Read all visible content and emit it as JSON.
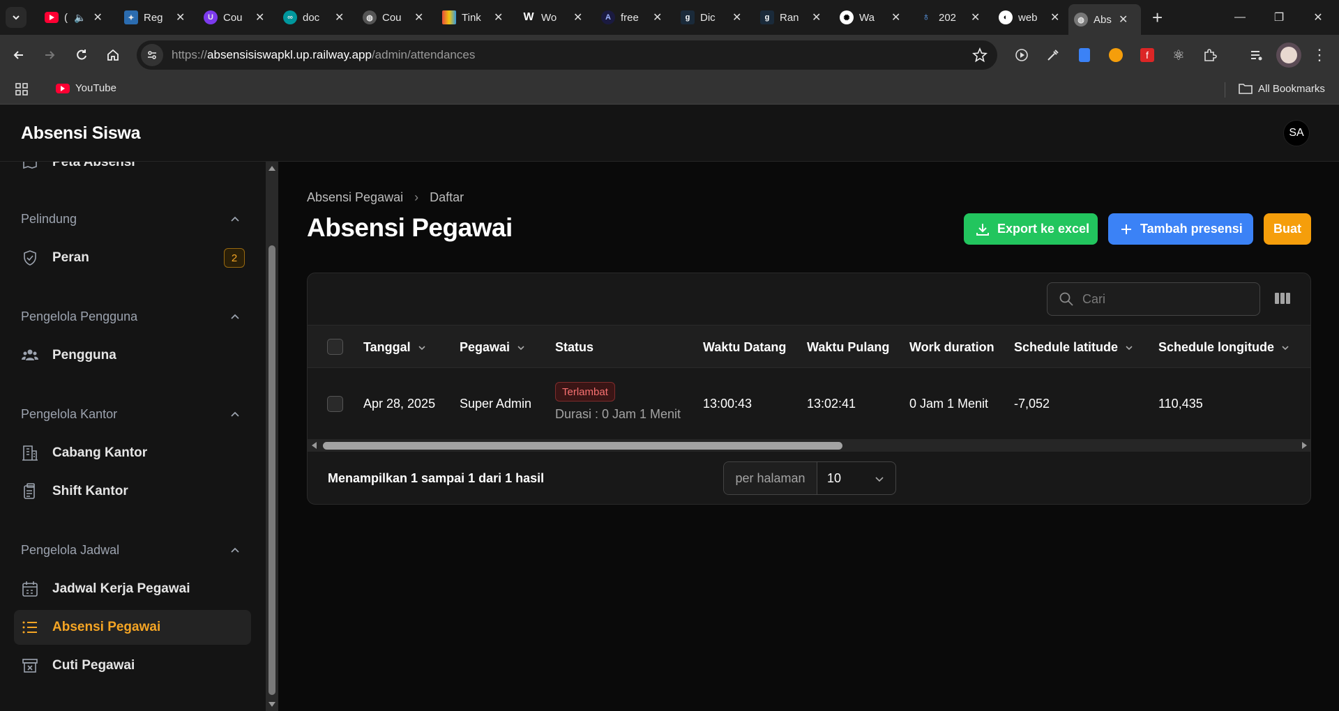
{
  "browser": {
    "tabs": [
      {
        "title": "(",
        "favicon": "youtube-icon",
        "color": "#ff0033"
      },
      {
        "title": "Reg",
        "favicon": "app-icon",
        "color": "#2b6cb0"
      },
      {
        "title": "Cou",
        "favicon": "u-icon",
        "color": "#7c3aed"
      },
      {
        "title": "doc",
        "favicon": "arduino-icon",
        "color": "#00979d"
      },
      {
        "title": "Cou",
        "favicon": "globe-icon",
        "color": "#888888"
      },
      {
        "title": "Tink",
        "favicon": "tinkercad-icon",
        "color": "#e74c3c"
      },
      {
        "title": "Wo",
        "favicon": "wordpress-icon",
        "color": "#ffffff"
      },
      {
        "title": "free",
        "favicon": "a-icon",
        "color": "#1a1a40"
      },
      {
        "title": "Dic",
        "favicon": "g-icon",
        "color": "#1a2a3a"
      },
      {
        "title": "Ran",
        "favicon": "g-icon",
        "color": "#1a2a3a"
      },
      {
        "title": "Wa",
        "favicon": "openai-icon",
        "color": "#ffffff"
      },
      {
        "title": "202",
        "favicon": "drop-icon",
        "color": "#2b6cb0"
      },
      {
        "title": "web",
        "favicon": "web-icon",
        "color": "#ffffff"
      },
      {
        "title": "Abs",
        "favicon": "globe-icon",
        "color": "#888888",
        "active": true
      }
    ],
    "url_prefix": "https://",
    "url_host": "absensisiswapkl.up.railway.app",
    "url_path": "/admin/attendances",
    "bookmarks": {
      "youtube": "YouTube",
      "all": "All Bookmarks"
    }
  },
  "app": {
    "brand": "Absensi Siswa",
    "avatar_initials": "SA"
  },
  "sidebar": {
    "partial_item": "Peta Absensi",
    "groups": [
      {
        "title": "Pelindung",
        "items": [
          {
            "label": "Peran",
            "icon": "shield-check-icon",
            "badge": "2"
          }
        ]
      },
      {
        "title": "Pengelola Pengguna",
        "items": [
          {
            "label": "Pengguna",
            "icon": "users-icon"
          }
        ]
      },
      {
        "title": "Pengelola Kantor",
        "items": [
          {
            "label": "Cabang Kantor",
            "icon": "building-icon"
          },
          {
            "label": "Shift Kantor",
            "icon": "clipboard-icon"
          }
        ]
      },
      {
        "title": "Pengelola Jadwal",
        "items": [
          {
            "label": "Jadwal Kerja Pegawai",
            "icon": "calendar-icon"
          },
          {
            "label": "Absensi Pegawai",
            "icon": "list-icon",
            "active": true
          },
          {
            "label": "Cuti Pegawai",
            "icon": "archive-icon"
          }
        ]
      }
    ]
  },
  "main": {
    "breadcrumb": [
      "Absensi Pegawai",
      "Daftar"
    ],
    "title": "Absensi Pegawai",
    "actions": {
      "export": "Export ke excel",
      "add": "Tambah presensi",
      "create": "Buat"
    },
    "colors": {
      "export": "#22c55e",
      "add": "#3b82f6",
      "create": "#f59e0b",
      "active_nav": "#f5a524"
    },
    "search_placeholder": "Cari",
    "columns": [
      "Tanggal",
      "Pegawai",
      "Status",
      "Waktu Datang",
      "Waktu Pulang",
      "Work duration",
      "Schedule latitude",
      "Schedule longitude"
    ],
    "rows": [
      {
        "tanggal": "Apr 28, 2025",
        "pegawai": "Super Admin",
        "status": "Terlambat",
        "durasi": "Durasi : 0 Jam 1 Menit",
        "waktu_datang": "13:00:43",
        "waktu_pulang": "13:02:41",
        "work_duration": "0 Jam 1 Menit",
        "latitude": "-7,052",
        "longitude": "110,435"
      }
    ],
    "pagination": {
      "summary": "Menampilkan 1 sampai 1 dari 1 hasil",
      "per_page_label": "per halaman",
      "per_page_value": "10"
    }
  }
}
